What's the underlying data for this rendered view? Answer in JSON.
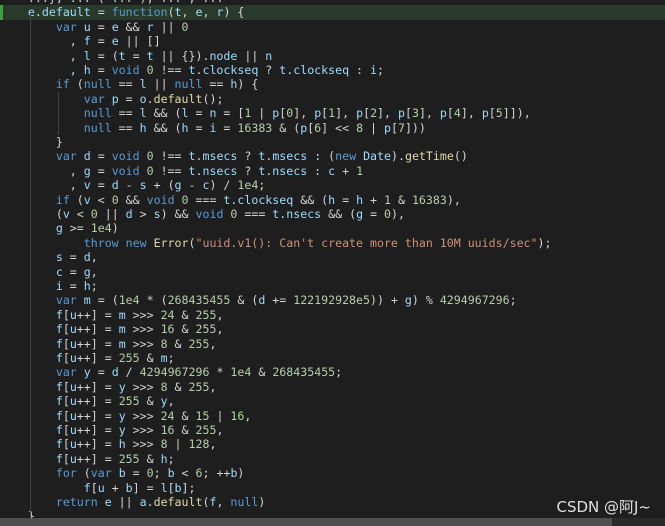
{
  "watermark": "CSDN @阿J~",
  "colors": {
    "background": "#1e1e1e",
    "keyword": "#569cd6",
    "function": "#dcdcaa",
    "variable": "#9cdcfe",
    "number": "#b5cea8",
    "string": "#ce9178",
    "text": "#d4d4d4"
  },
  "scrollbar": {
    "horizontal_fraction": 0.92
  },
  "code": {
    "lines": [
      "    ...}, ... ( ... ), ... , ...",
      "    e.default = function(t, e, r) {",
      "        var u = e && r || 0",
      "          , f = e || []",
      "          , l = (t = t || {}).node || n",
      "          , h = void 0 !== t.clockseq ? t.clockseq : i;",
      "        if (null == l || null == h) {",
      "            var p = o.default();",
      "            null == l && (l = n = [1 | p[0], p[1], p[2], p[3], p[4], p[5]]),",
      "            null == h && (h = i = 16383 & (p[6] << 8 | p[7]))",
      "        }",
      "        var d = void 0 !== t.msecs ? t.msecs : (new Date).getTime()",
      "          , g = void 0 !== t.nsecs ? t.nsecs : c + 1",
      "          , v = d - s + (g - c) / 1e4;",
      "        if (v < 0 && void 0 === t.clockseq && (h = h + 1 & 16383),",
      "        (v < 0 || d > s) && void 0 === t.nsecs && (g = 0),",
      "        g >= 1e4)",
      "            throw new Error(\"uuid.v1(): Can't create more than 10M uuids/sec\");",
      "        s = d,",
      "        c = g,",
      "        i = h;",
      "        var m = (1e4 * (268435455 & (d += 122192928e5)) + g) % 4294967296;",
      "        f[u++] = m >>> 24 & 255,",
      "        f[u++] = m >>> 16 & 255,",
      "        f[u++] = m >>> 8 & 255,",
      "        f[u++] = 255 & m;",
      "        var y = d / 4294967296 * 1e4 & 268435455;",
      "        f[u++] = y >>> 8 & 255,",
      "        f[u++] = 255 & y,",
      "        f[u++] = y >>> 24 & 15 | 16,",
      "        f[u++] = y >>> 16 & 255,",
      "        f[u++] = h >>> 8 | 128,",
      "        f[u++] = 255 & h;",
      "        for (var b = 0; b < 6; ++b)",
      "            f[u + b] = l[b];",
      "        return e || a.default(f, null)",
      "    }"
    ]
  }
}
